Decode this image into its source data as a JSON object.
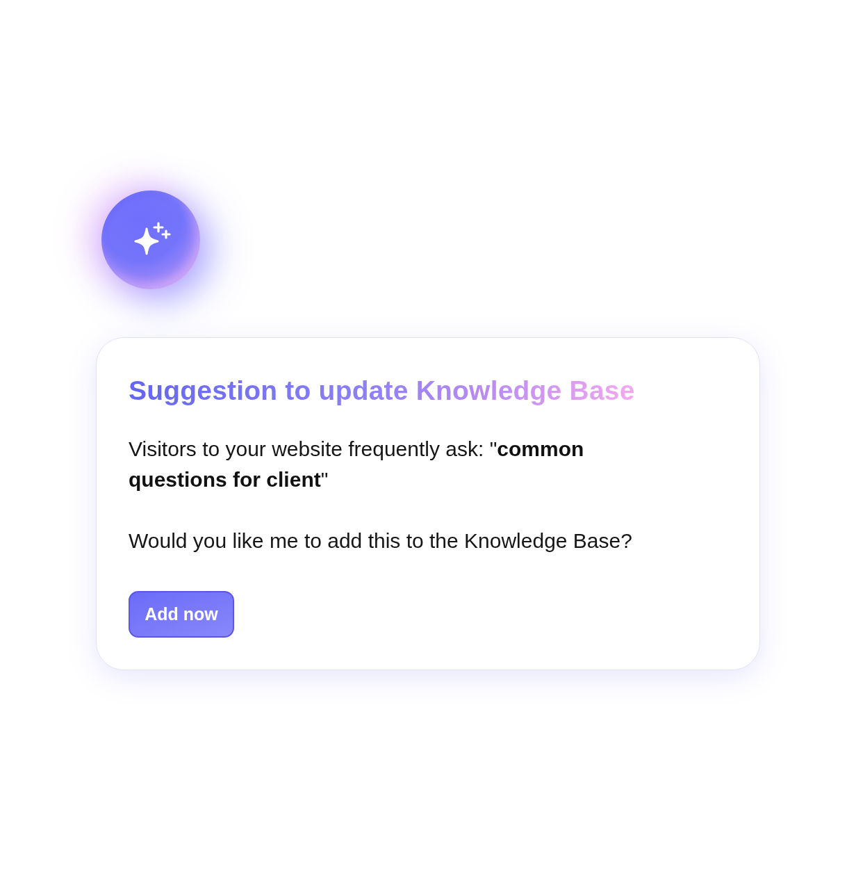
{
  "suggestion_card": {
    "title": "Suggestion to update Knowledge Base",
    "message": "Visitors to your website frequently ask: \"**common questions for client**\"",
    "question": "Would you like me to add this to the Knowledge Base?",
    "button": {
      "label": "Add now"
    }
  }
}
